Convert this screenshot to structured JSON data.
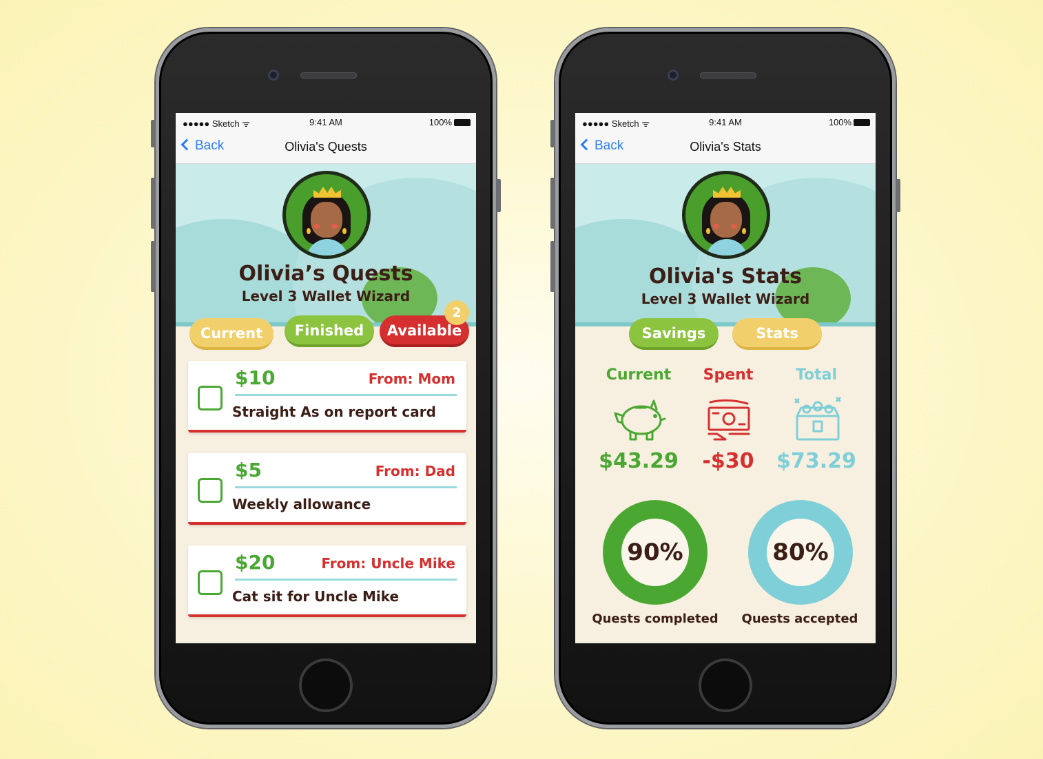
{
  "status": {
    "carrier": "●●●●● Sketch",
    "wifi": "ᯤ",
    "time": "9:41 AM",
    "battery": "100%"
  },
  "phone1": {
    "nav": {
      "back": "Back",
      "title": "Olivia's Quests"
    },
    "hero": {
      "title": "Olivia’s Quests",
      "subtitle": "Level 3 Wallet Wizard"
    },
    "tabs": {
      "current": "Current",
      "finished": "Finished",
      "available": "Available",
      "available_badge": "2"
    },
    "quests": [
      {
        "amount": "$10",
        "from": "From: Mom",
        "desc": "Straight As on report card"
      },
      {
        "amount": "$5",
        "from": "From: Dad",
        "desc": "Weekly allowance"
      },
      {
        "amount": "$20",
        "from": "From: Uncle Mike",
        "desc": "Cat sit for Uncle Mike"
      }
    ]
  },
  "phone2": {
    "nav": {
      "back": "Back",
      "title": "Olivia's Stats"
    },
    "hero": {
      "title": "Olivia's Stats",
      "subtitle": "Level 3 Wallet Wizard"
    },
    "tabs": {
      "savings": "Savings",
      "stats": "Stats"
    },
    "stats": [
      {
        "label": "Current",
        "value": "$43.29",
        "color": "#4aa832",
        "icon": "piggy-bank-icon"
      },
      {
        "label": "Spent",
        "value": "-$30",
        "color": "#d5302f",
        "icon": "money-spent-icon"
      },
      {
        "label": "Total",
        "value": "$73.29",
        "color": "#7fcfd8",
        "icon": "treasure-chest-icon"
      }
    ],
    "rings": [
      {
        "value": "90%",
        "label": "Quests completed",
        "fraction": 0.9,
        "color": "#4aa832"
      },
      {
        "value": "80%",
        "label": "Quests accepted",
        "fraction": 0.8,
        "color": "#7fcfd8"
      }
    ]
  }
}
